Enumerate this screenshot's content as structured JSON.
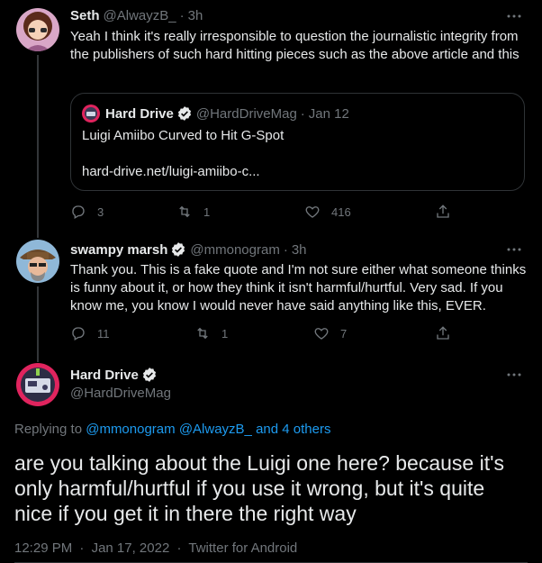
{
  "tweets": [
    {
      "name": "Seth",
      "handle": "@AlwayzB_",
      "time": "3h",
      "text": "Yeah I think it's really irresponsible to question the journalistic integrity from the publishers of such hard hitting pieces such as the above article and this",
      "quote": {
        "name": "Hard Drive",
        "handle": "@HardDriveMag",
        "date": "Jan 12",
        "title": "Luigi Amiibo Curved to Hit G-Spot",
        "link": "hard-drive.net/luigi-amiibo-c..."
      },
      "replies": "3",
      "retweets": "1",
      "likes": "416"
    },
    {
      "name": "swampy marsh",
      "handle": "@mmonogram",
      "time": "3h",
      "text": "Thank you. This is a fake quote and I'm not sure either what someone thinks is funny about it, or how they think it isn't harmful/hurtful. Very sad. If you know me, you know I would never have said anything like this, EVER.",
      "replies": "11",
      "retweets": "1",
      "likes": "7"
    }
  ],
  "main": {
    "name": "Hard Drive",
    "handle": "@HardDriveMag",
    "replying_prefix": "Replying to",
    "replying_1": "@mmonogram",
    "replying_2": "@AlwayzB_",
    "replying_3": "and 4 others",
    "text": "are you talking about the Luigi one here? because it's only harmful/hurtful if you use it wrong, but it's quite nice if you get it in there the right way",
    "timestamp": "12:29 PM",
    "date": "Jan 17, 2022",
    "client": "Twitter for Android"
  },
  "colors": {
    "accent": "#1d9bf0",
    "muted": "#71767b",
    "text": "#e7e9ea",
    "background": "#000000"
  },
  "icons": [
    "more-icon",
    "verified-icon",
    "reply-icon",
    "retweet-icon",
    "like-icon",
    "share-icon"
  ]
}
